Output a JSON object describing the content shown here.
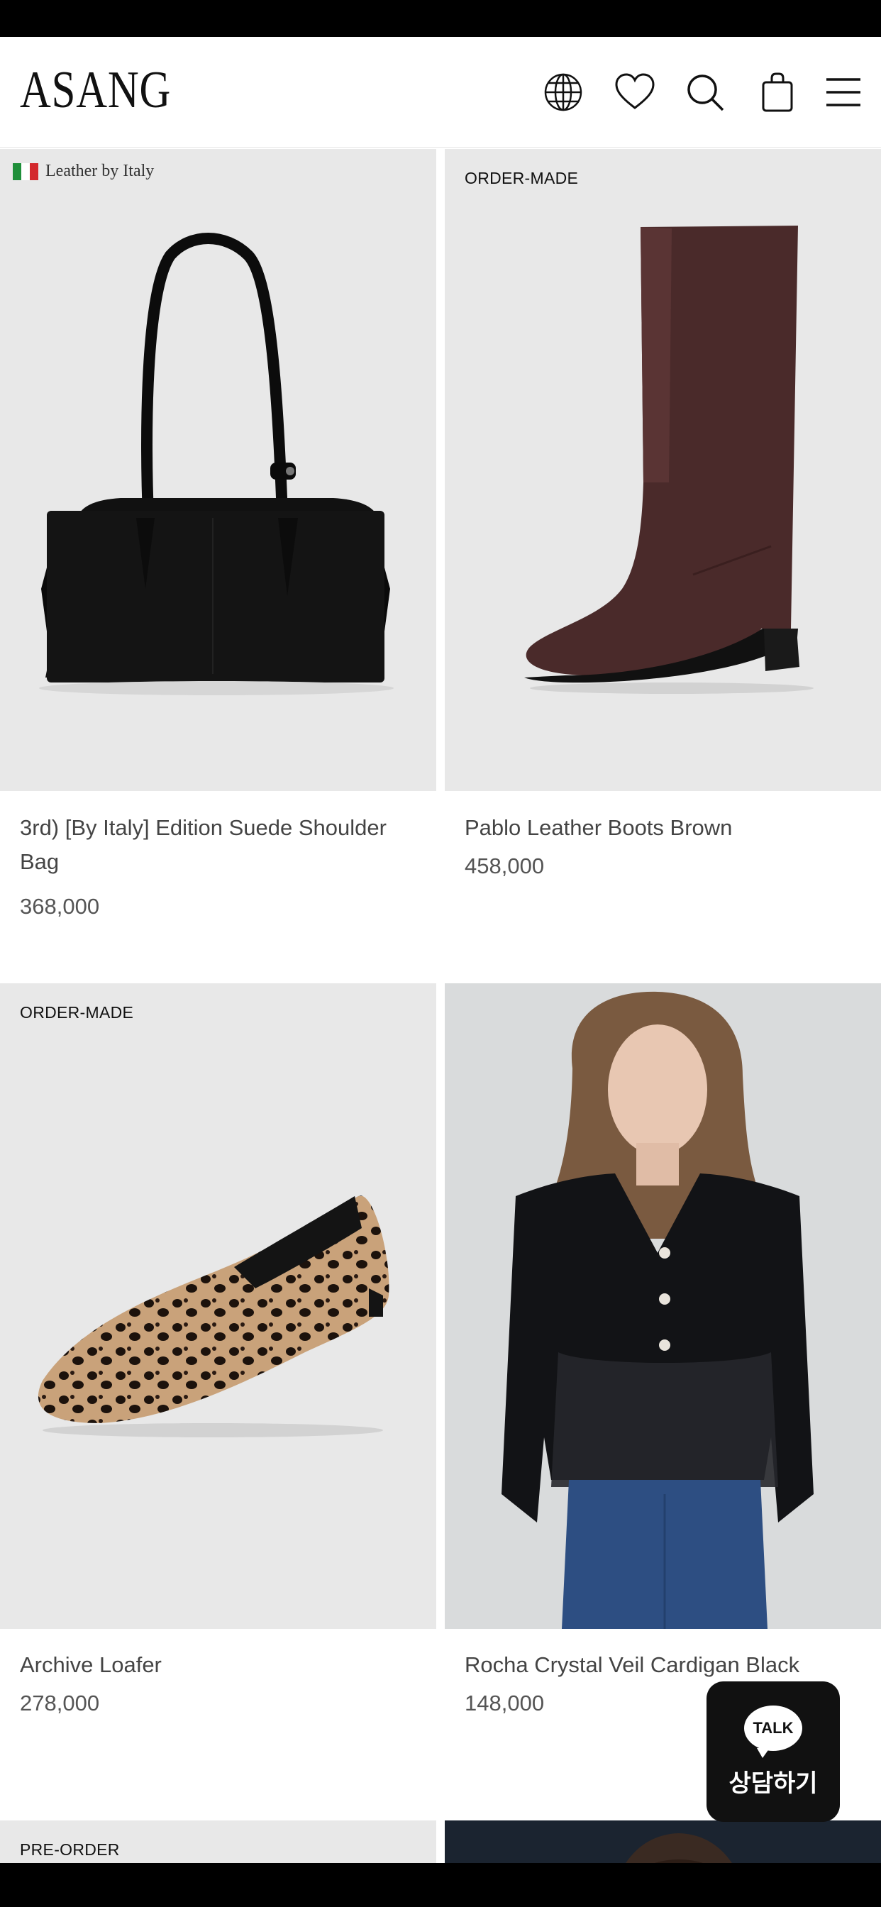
{
  "header": {
    "logo": "ASANG",
    "icons": [
      "globe-icon",
      "heart-icon",
      "search-icon",
      "bag-icon",
      "menu-icon"
    ]
  },
  "products": [
    {
      "tag": "Leather by Italy",
      "name": "3rd) [By Italy] Edition Suede Shoulder Bag",
      "price": "368,000"
    },
    {
      "tag": "ORDER-MADE",
      "name": "Pablo Leather Boots Brown",
      "price": "458,000"
    },
    {
      "tag": "ORDER-MADE",
      "name": "Archive Loafer",
      "price": "278,000"
    },
    {
      "tag": "",
      "name": "Rocha Crystal Veil Cardigan Black",
      "price": "148,000"
    },
    {
      "tag": "PRE-ORDER",
      "name": "",
      "price": ""
    }
  ],
  "talk_button": {
    "bubble": "TALK",
    "label": "상담하기"
  },
  "colors": {
    "background": "#ffffff",
    "image_bg": "#e8e8e8",
    "text": "#444444",
    "flag_green": "#1f8f3a",
    "flag_red": "#d3282c"
  }
}
